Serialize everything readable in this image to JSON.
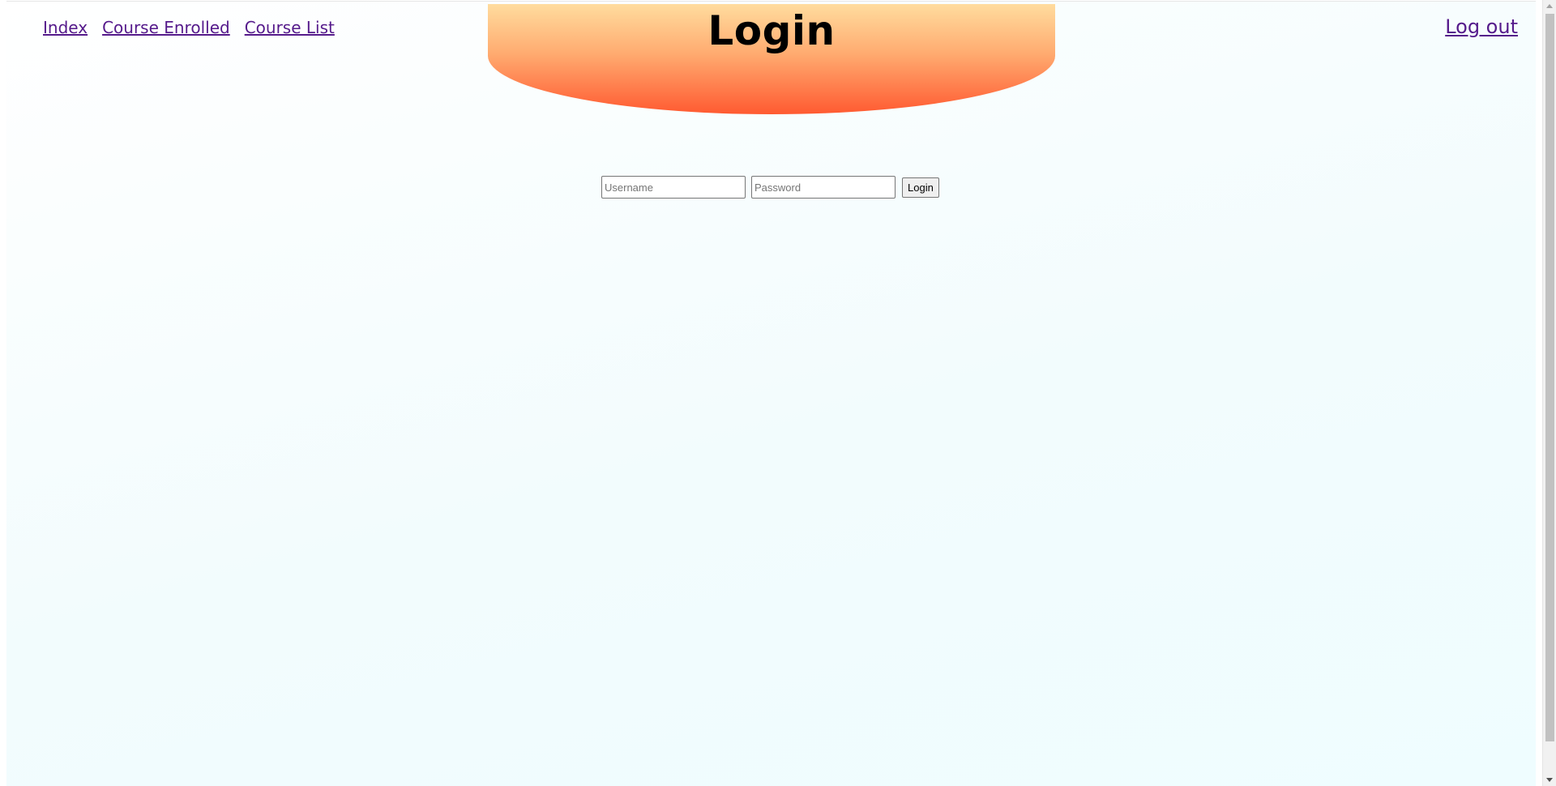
{
  "nav": {
    "items": [
      {
        "label": "Index"
      },
      {
        "label": "Course Enrolled"
      },
      {
        "label": "Course List"
      }
    ],
    "logout_label": "Log out"
  },
  "header": {
    "title": "Login",
    "gradient_colors": [
      "#ffdc9e",
      "#ffab70",
      "#ff5a31"
    ]
  },
  "login_form": {
    "username_placeholder": "Username",
    "password_placeholder": "Password",
    "submit_label": "Login"
  },
  "colors": {
    "link": "#551a8b",
    "background": "#f2fcfd"
  }
}
